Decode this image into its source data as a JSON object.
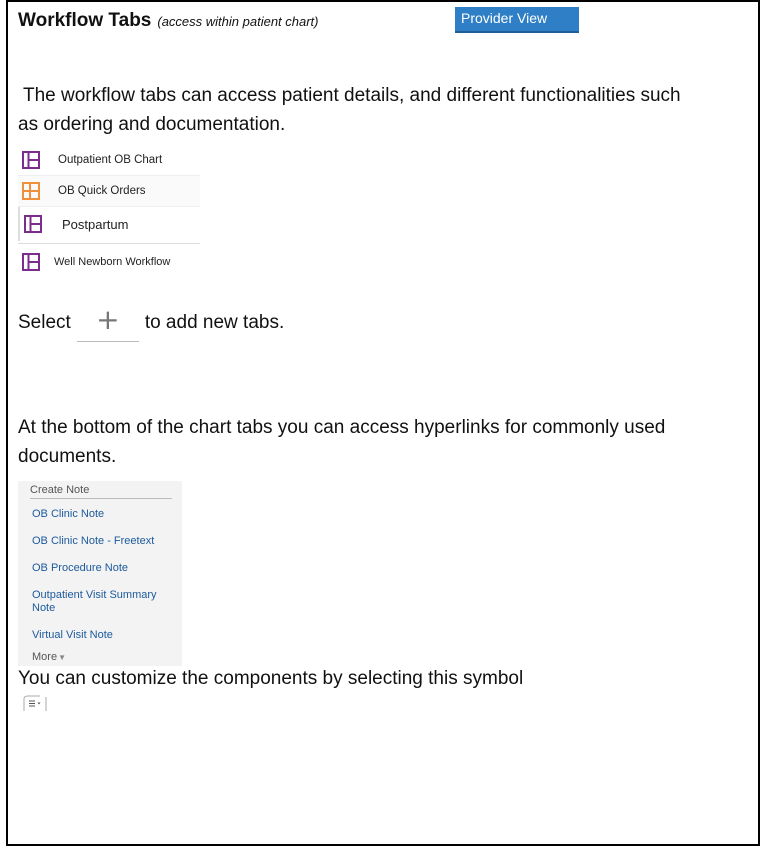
{
  "header": {
    "title": "Workflow Tabs",
    "subtitle": "(access within patient chart)",
    "provider_view_button": "Provider View"
  },
  "intro": {
    "text": "The workflow tabs can access patient details, and different functionalities such as ordering and documentation."
  },
  "workflow_tabs": [
    {
      "label": "Outpatient OB Chart",
      "icon": "layout-icon",
      "color": "#7b2c8c"
    },
    {
      "label": "OB Quick Orders",
      "icon": "layout-icon",
      "color": "#f0903a"
    },
    {
      "label": "Postpartum",
      "icon": "layout-icon",
      "color": "#7b2c8c"
    },
    {
      "label": "Well Newborn Workflow",
      "icon": "layout-icon",
      "color": "#7b2c8c"
    }
  ],
  "add_tabs": {
    "prefix": "Select",
    "plus_symbol": "+",
    "suffix": "to add new tabs."
  },
  "hyperlinks_intro": {
    "text": "At the bottom of the chart tabs you can access hyperlinks for commonly used documents."
  },
  "create_note": {
    "header": "Create Note",
    "items": [
      "OB Clinic Note",
      "OB Clinic Note - Freetext",
      "OB Procedure Note",
      "Outpatient Visit Summary Note",
      "Virtual Visit Note"
    ],
    "more": "More"
  },
  "customize": {
    "text": "You can customize the components by selecting this symbol"
  }
}
